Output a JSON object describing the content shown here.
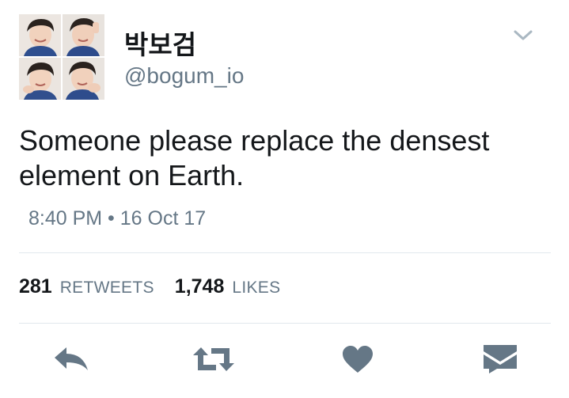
{
  "user": {
    "display_name": "박보검",
    "handle": "@bogum_io",
    "avatar_icon": "profile-photo-collage"
  },
  "tweet": {
    "text_line1": "Someone please replace the densest",
    "text_line2": "element on Earth.",
    "timestamp": "8:40 PM • 16 Oct 17"
  },
  "stats": {
    "retweets_count": "281",
    "retweets_label": "RETWEETS",
    "likes_count": "1,748",
    "likes_label": "LIKES"
  },
  "actions": {
    "icons": [
      "reply-icon",
      "retweet-icon",
      "like-icon",
      "direct-message-icon"
    ],
    "more_icon": "chevron-down-icon"
  },
  "colors": {
    "primary_text": "#14171a",
    "secondary_text": "#657786",
    "icon": "#657786",
    "divider": "#e1e8ed",
    "background": "#ffffff"
  }
}
